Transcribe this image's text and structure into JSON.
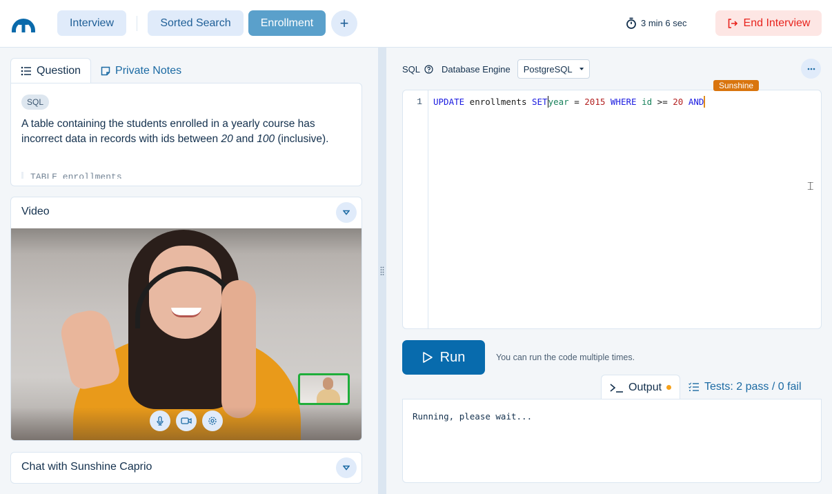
{
  "header": {
    "logo": "interview-platform-logo",
    "tabs": [
      {
        "label": "Interview",
        "state": "default"
      },
      {
        "label": "Sorted Search",
        "state": "default"
      },
      {
        "label": "Enrollment",
        "state": "active"
      }
    ],
    "add_tab_label": "+",
    "timer": "3 min 6 sec",
    "end_button": "End Interview"
  },
  "question_panel": {
    "tabs": [
      {
        "label": "Question",
        "icon": "list-icon",
        "active": true
      },
      {
        "label": "Private Notes",
        "icon": "note-icon",
        "active": false
      }
    ],
    "badge": "SQL",
    "text_part1": "A table containing the students enrolled in a yearly course has incorrect data in records with ids between ",
    "num_low": "20",
    "text_and": " and ",
    "num_high": "100",
    "text_part2": " (inclusive).",
    "truncated_next": "TABLE enrollments"
  },
  "video_panel": {
    "title": "Video",
    "controls": [
      "microphone-icon",
      "camera-icon",
      "settings-icon"
    ]
  },
  "chat_panel": {
    "title": "Chat with Sunshine Caprio"
  },
  "editor_toolbar": {
    "language": "SQL",
    "engine_label": "Database Engine",
    "engine_value": "PostgreSQL"
  },
  "editor": {
    "line_number": "1",
    "tokens": {
      "t1": "UPDATE",
      "t2": " enrollments ",
      "t3": "SET",
      "t4": "year",
      "t5": " = ",
      "t6": "2015",
      "t7": " ",
      "t8": "WHERE",
      "t9": " ",
      "t10": "id",
      "t11": " >= ",
      "t12": "20",
      "t13": " ",
      "t14": "AND"
    },
    "remote_user": "Sunshine",
    "colors": {
      "keyword": "#1a1ae0",
      "identifier": "#18815b",
      "number": "#b32222",
      "remote_cursor": "#d9750e"
    }
  },
  "run": {
    "label": "Run",
    "hint": "You can run the code multiple times."
  },
  "output_panel": {
    "tabs": [
      {
        "label": "Output",
        "active": true,
        "indicator": "pending"
      },
      {
        "label": "Tests: 2 pass / 0 fail",
        "active": false
      }
    ],
    "text": "Running, please wait..."
  }
}
